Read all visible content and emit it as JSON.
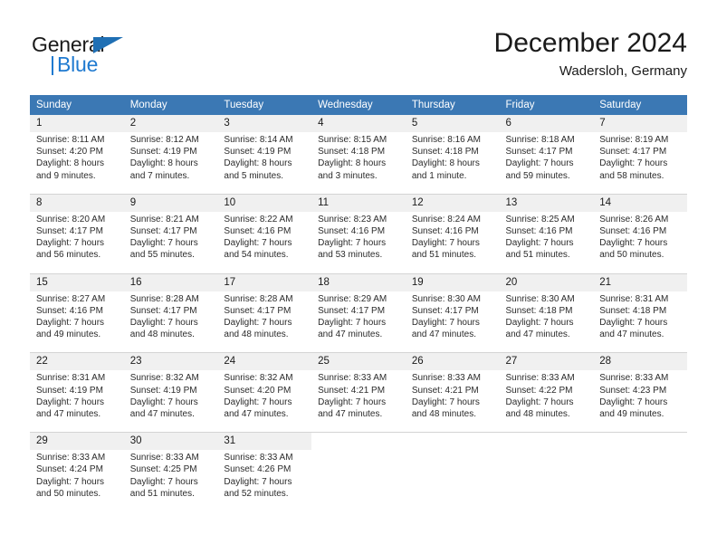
{
  "logo": {
    "word_top": "General",
    "word_bottom": "Blue",
    "accent_color": "#1f7ad0"
  },
  "header": {
    "title": "December 2024",
    "subtitle": "Wadersloh, Germany"
  },
  "calendar": {
    "header_bg": "#3b78b4",
    "daynum_bg": "#f0f0f0",
    "weekdays": [
      "Sunday",
      "Monday",
      "Tuesday",
      "Wednesday",
      "Thursday",
      "Friday",
      "Saturday"
    ],
    "weeks": [
      [
        {
          "day": "1",
          "sunrise": "Sunrise: 8:11 AM",
          "sunset": "Sunset: 4:20 PM",
          "daylight1": "Daylight: 8 hours",
          "daylight2": "and 9 minutes."
        },
        {
          "day": "2",
          "sunrise": "Sunrise: 8:12 AM",
          "sunset": "Sunset: 4:19 PM",
          "daylight1": "Daylight: 8 hours",
          "daylight2": "and 7 minutes."
        },
        {
          "day": "3",
          "sunrise": "Sunrise: 8:14 AM",
          "sunset": "Sunset: 4:19 PM",
          "daylight1": "Daylight: 8 hours",
          "daylight2": "and 5 minutes."
        },
        {
          "day": "4",
          "sunrise": "Sunrise: 8:15 AM",
          "sunset": "Sunset: 4:18 PM",
          "daylight1": "Daylight: 8 hours",
          "daylight2": "and 3 minutes."
        },
        {
          "day": "5",
          "sunrise": "Sunrise: 8:16 AM",
          "sunset": "Sunset: 4:18 PM",
          "daylight1": "Daylight: 8 hours",
          "daylight2": "and 1 minute."
        },
        {
          "day": "6",
          "sunrise": "Sunrise: 8:18 AM",
          "sunset": "Sunset: 4:17 PM",
          "daylight1": "Daylight: 7 hours",
          "daylight2": "and 59 minutes."
        },
        {
          "day": "7",
          "sunrise": "Sunrise: 8:19 AM",
          "sunset": "Sunset: 4:17 PM",
          "daylight1": "Daylight: 7 hours",
          "daylight2": "and 58 minutes."
        }
      ],
      [
        {
          "day": "8",
          "sunrise": "Sunrise: 8:20 AM",
          "sunset": "Sunset: 4:17 PM",
          "daylight1": "Daylight: 7 hours",
          "daylight2": "and 56 minutes."
        },
        {
          "day": "9",
          "sunrise": "Sunrise: 8:21 AM",
          "sunset": "Sunset: 4:17 PM",
          "daylight1": "Daylight: 7 hours",
          "daylight2": "and 55 minutes."
        },
        {
          "day": "10",
          "sunrise": "Sunrise: 8:22 AM",
          "sunset": "Sunset: 4:16 PM",
          "daylight1": "Daylight: 7 hours",
          "daylight2": "and 54 minutes."
        },
        {
          "day": "11",
          "sunrise": "Sunrise: 8:23 AM",
          "sunset": "Sunset: 4:16 PM",
          "daylight1": "Daylight: 7 hours",
          "daylight2": "and 53 minutes."
        },
        {
          "day": "12",
          "sunrise": "Sunrise: 8:24 AM",
          "sunset": "Sunset: 4:16 PM",
          "daylight1": "Daylight: 7 hours",
          "daylight2": "and 51 minutes."
        },
        {
          "day": "13",
          "sunrise": "Sunrise: 8:25 AM",
          "sunset": "Sunset: 4:16 PM",
          "daylight1": "Daylight: 7 hours",
          "daylight2": "and 51 minutes."
        },
        {
          "day": "14",
          "sunrise": "Sunrise: 8:26 AM",
          "sunset": "Sunset: 4:16 PM",
          "daylight1": "Daylight: 7 hours",
          "daylight2": "and 50 minutes."
        }
      ],
      [
        {
          "day": "15",
          "sunrise": "Sunrise: 8:27 AM",
          "sunset": "Sunset: 4:16 PM",
          "daylight1": "Daylight: 7 hours",
          "daylight2": "and 49 minutes."
        },
        {
          "day": "16",
          "sunrise": "Sunrise: 8:28 AM",
          "sunset": "Sunset: 4:17 PM",
          "daylight1": "Daylight: 7 hours",
          "daylight2": "and 48 minutes."
        },
        {
          "day": "17",
          "sunrise": "Sunrise: 8:28 AM",
          "sunset": "Sunset: 4:17 PM",
          "daylight1": "Daylight: 7 hours",
          "daylight2": "and 48 minutes."
        },
        {
          "day": "18",
          "sunrise": "Sunrise: 8:29 AM",
          "sunset": "Sunset: 4:17 PM",
          "daylight1": "Daylight: 7 hours",
          "daylight2": "and 47 minutes."
        },
        {
          "day": "19",
          "sunrise": "Sunrise: 8:30 AM",
          "sunset": "Sunset: 4:17 PM",
          "daylight1": "Daylight: 7 hours",
          "daylight2": "and 47 minutes."
        },
        {
          "day": "20",
          "sunrise": "Sunrise: 8:30 AM",
          "sunset": "Sunset: 4:18 PM",
          "daylight1": "Daylight: 7 hours",
          "daylight2": "and 47 minutes."
        },
        {
          "day": "21",
          "sunrise": "Sunrise: 8:31 AM",
          "sunset": "Sunset: 4:18 PM",
          "daylight1": "Daylight: 7 hours",
          "daylight2": "and 47 minutes."
        }
      ],
      [
        {
          "day": "22",
          "sunrise": "Sunrise: 8:31 AM",
          "sunset": "Sunset: 4:19 PM",
          "daylight1": "Daylight: 7 hours",
          "daylight2": "and 47 minutes."
        },
        {
          "day": "23",
          "sunrise": "Sunrise: 8:32 AM",
          "sunset": "Sunset: 4:19 PM",
          "daylight1": "Daylight: 7 hours",
          "daylight2": "and 47 minutes."
        },
        {
          "day": "24",
          "sunrise": "Sunrise: 8:32 AM",
          "sunset": "Sunset: 4:20 PM",
          "daylight1": "Daylight: 7 hours",
          "daylight2": "and 47 minutes."
        },
        {
          "day": "25",
          "sunrise": "Sunrise: 8:33 AM",
          "sunset": "Sunset: 4:21 PM",
          "daylight1": "Daylight: 7 hours",
          "daylight2": "and 47 minutes."
        },
        {
          "day": "26",
          "sunrise": "Sunrise: 8:33 AM",
          "sunset": "Sunset: 4:21 PM",
          "daylight1": "Daylight: 7 hours",
          "daylight2": "and 48 minutes."
        },
        {
          "day": "27",
          "sunrise": "Sunrise: 8:33 AM",
          "sunset": "Sunset: 4:22 PM",
          "daylight1": "Daylight: 7 hours",
          "daylight2": "and 48 minutes."
        },
        {
          "day": "28",
          "sunrise": "Sunrise: 8:33 AM",
          "sunset": "Sunset: 4:23 PM",
          "daylight1": "Daylight: 7 hours",
          "daylight2": "and 49 minutes."
        }
      ],
      [
        {
          "day": "29",
          "sunrise": "Sunrise: 8:33 AM",
          "sunset": "Sunset: 4:24 PM",
          "daylight1": "Daylight: 7 hours",
          "daylight2": "and 50 minutes."
        },
        {
          "day": "30",
          "sunrise": "Sunrise: 8:33 AM",
          "sunset": "Sunset: 4:25 PM",
          "daylight1": "Daylight: 7 hours",
          "daylight2": "and 51 minutes."
        },
        {
          "day": "31",
          "sunrise": "Sunrise: 8:33 AM",
          "sunset": "Sunset: 4:26 PM",
          "daylight1": "Daylight: 7 hours",
          "daylight2": "and 52 minutes."
        },
        {
          "day": "",
          "sunrise": "",
          "sunset": "",
          "daylight1": "",
          "daylight2": ""
        },
        {
          "day": "",
          "sunrise": "",
          "sunset": "",
          "daylight1": "",
          "daylight2": ""
        },
        {
          "day": "",
          "sunrise": "",
          "sunset": "",
          "daylight1": "",
          "daylight2": ""
        },
        {
          "day": "",
          "sunrise": "",
          "sunset": "",
          "daylight1": "",
          "daylight2": ""
        }
      ]
    ]
  }
}
